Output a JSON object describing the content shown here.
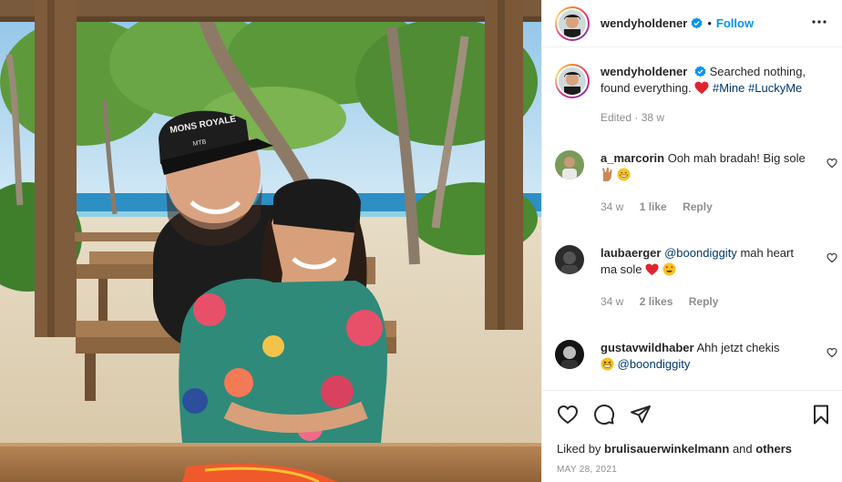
{
  "header": {
    "username": "wendyholdener",
    "separator": "•",
    "follow_label": "Follow"
  },
  "caption": {
    "username": "wendyholdener",
    "text_before": "Searched nothing, found everything.",
    "hashtags": "#Mine #LuckyMe",
    "edited": "Edited",
    "age": "38 w"
  },
  "comments": [
    {
      "username": "a_marcorin",
      "text": "Ooh mah bradah! Big sole",
      "age": "34 w",
      "likes": "1 like",
      "reply": "Reply"
    },
    {
      "username": "laubaerger",
      "mention": "@boondiggity",
      "text": "mah heart ma sole",
      "age": "34 w",
      "likes": "2 likes",
      "reply": "Reply"
    },
    {
      "username": "gustavwildhaber",
      "text": "Ahh jetzt chekis",
      "mention": "@boondiggity"
    }
  ],
  "footer": {
    "liked_prefix": "Liked by",
    "liked_user": "brulisauerwinkelmann",
    "liked_and": "and",
    "liked_others": "others",
    "date": "MAY 28, 2021"
  },
  "photo": {
    "cap_text": "MONS ROYALE",
    "cap_sub": "MTB"
  },
  "colors": {
    "accent": "#0095f6",
    "link": "#00376b",
    "muted": "#8e8e8e",
    "heart": "#ed4956"
  }
}
